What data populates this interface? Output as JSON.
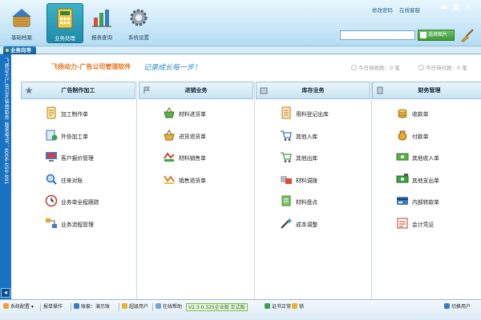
{
  "toolbar": {
    "buttons": [
      {
        "label": "基础档案",
        "icon": "home-basket-icon"
      },
      {
        "label": "业务处理",
        "icon": "calculator-icon",
        "active": true
      },
      {
        "label": "报表查询",
        "icon": "bar-chart-icon"
      },
      {
        "label": "系统设置",
        "icon": "gear-icon"
      }
    ],
    "links": [
      "修改密码",
      "在线客服"
    ],
    "search_button": "选择图片",
    "search_value": ""
  },
  "tabs": [
    {
      "label": "业务向导",
      "active": true
    }
  ],
  "left_banner": "飞扬动力广告公司管理软件 服务电话：4006-059-891",
  "main": {
    "brand": "飞扬动力-广告公司管理软件",
    "slogan": "记录成长每一步！",
    "today_pending_receive": "今日待收款：0 笔",
    "today_pending_pay": "今日待付款：0 笔"
  },
  "columns": [
    {
      "title": "广告制作加工",
      "items": [
        {
          "label": "加工制作单",
          "icon": "document-list-icon"
        },
        {
          "label": "外协加工单",
          "icon": "outsource-icon"
        },
        {
          "label": "客户报价管理",
          "icon": "quote-monitor-icon"
        },
        {
          "label": "往来对账",
          "icon": "search-icon"
        },
        {
          "label": "业务单全程跟踪",
          "icon": "clock-track-icon"
        },
        {
          "label": "业务流程管理",
          "icon": "flow-icon"
        }
      ]
    },
    {
      "title": "进销业务",
      "items": [
        {
          "label": "材料进货单",
          "icon": "basket-in-icon"
        },
        {
          "label": "进货退货单",
          "icon": "basket-return-icon"
        },
        {
          "label": "材料销售单",
          "icon": "sales-icon"
        },
        {
          "label": "销售退货单",
          "icon": "sales-return-icon"
        }
      ]
    },
    {
      "title": "库存业务",
      "items": [
        {
          "label": "用料登记出库",
          "icon": "register-out-icon"
        },
        {
          "label": "其他入库",
          "icon": "cart-in-icon"
        },
        {
          "label": "其他出库",
          "icon": "cart-out-icon"
        },
        {
          "label": "材料调拨",
          "icon": "transfer-icon"
        },
        {
          "label": "材料盘点",
          "icon": "inventory-icon"
        },
        {
          "label": "成本调整",
          "icon": "magic-wand-icon"
        }
      ]
    },
    {
      "title": "财务管理",
      "items": [
        {
          "label": "收款单",
          "icon": "coins-in-icon"
        },
        {
          "label": "付款单",
          "icon": "money-bag-icon"
        },
        {
          "label": "其他收入单",
          "icon": "cash-in-icon"
        },
        {
          "label": "其他支出单",
          "icon": "cash-out-icon"
        },
        {
          "label": "内部转款单",
          "icon": "card-transfer-icon"
        },
        {
          "label": "会计凭证",
          "icon": "voucher-icon"
        }
      ]
    }
  ],
  "statusbar": {
    "items": [
      "系统配置 ▾",
      "报单操作",
      "账套：演示账",
      "超级用户",
      "在线帮助",
      "V2.3.0.325企业版 正式版",
      "证书正常",
      "锁",
      "切换用户"
    ]
  },
  "colors": {
    "accent_blue": "#1a72c2",
    "brand_orange": "#e8731a",
    "slogan_blue": "#2a8acb",
    "active_teal": "#1e8aa8"
  }
}
